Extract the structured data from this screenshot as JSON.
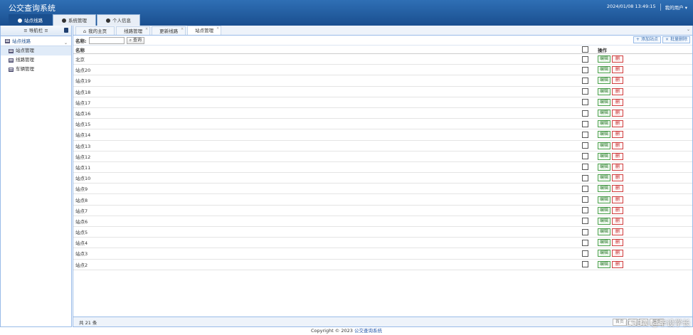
{
  "header": {
    "title": "公交查询系统",
    "datetime": "2024/01/08 13:49:15",
    "user_menu": "我的用户"
  },
  "top_tabs": [
    {
      "label": "站点线路"
    },
    {
      "label": "系统管理"
    },
    {
      "label": "个人信息"
    }
  ],
  "sidebar": {
    "title": "导航栏",
    "group": "站点线路",
    "items": [
      {
        "label": "站点管理"
      },
      {
        "label": "线路管理"
      },
      {
        "label": "车辆管理"
      }
    ]
  },
  "tabs": [
    {
      "label": "我的主页"
    },
    {
      "label": "线路管理"
    },
    {
      "label": "更新线路"
    },
    {
      "label": "站点管理"
    }
  ],
  "toolbar": {
    "name_label": "名称:",
    "search_label": "查询",
    "add_label": "添加站点",
    "batch_delete_label": "批量删除"
  },
  "grid": {
    "header_name": "名称",
    "header_ops": "操作",
    "edit_label": "编辑",
    "delete_label": "删",
    "rows": [
      "北京",
      "站点20",
      "站点19",
      "站点18",
      "站点17",
      "站点16",
      "站点15",
      "站点14",
      "站点13",
      "站点12",
      "站点11",
      "站点10",
      "站点9",
      "站点8",
      "站点7",
      "站点6",
      "站点5",
      "站点4",
      "站点3",
      "站点2"
    ]
  },
  "pager": {
    "total": "共 21 条",
    "first": "首页",
    "prev": "<",
    "next": ">",
    "last": "尾页"
  },
  "footer": {
    "copyright": "Copyright © 2023",
    "link": "公交查询系统"
  },
  "watermark": "CSDN @毕设学长",
  "colors": {
    "header": "#1a4f8f",
    "border": "#99bbe8",
    "edit": "#4aa04a",
    "delete": "#d04040"
  }
}
